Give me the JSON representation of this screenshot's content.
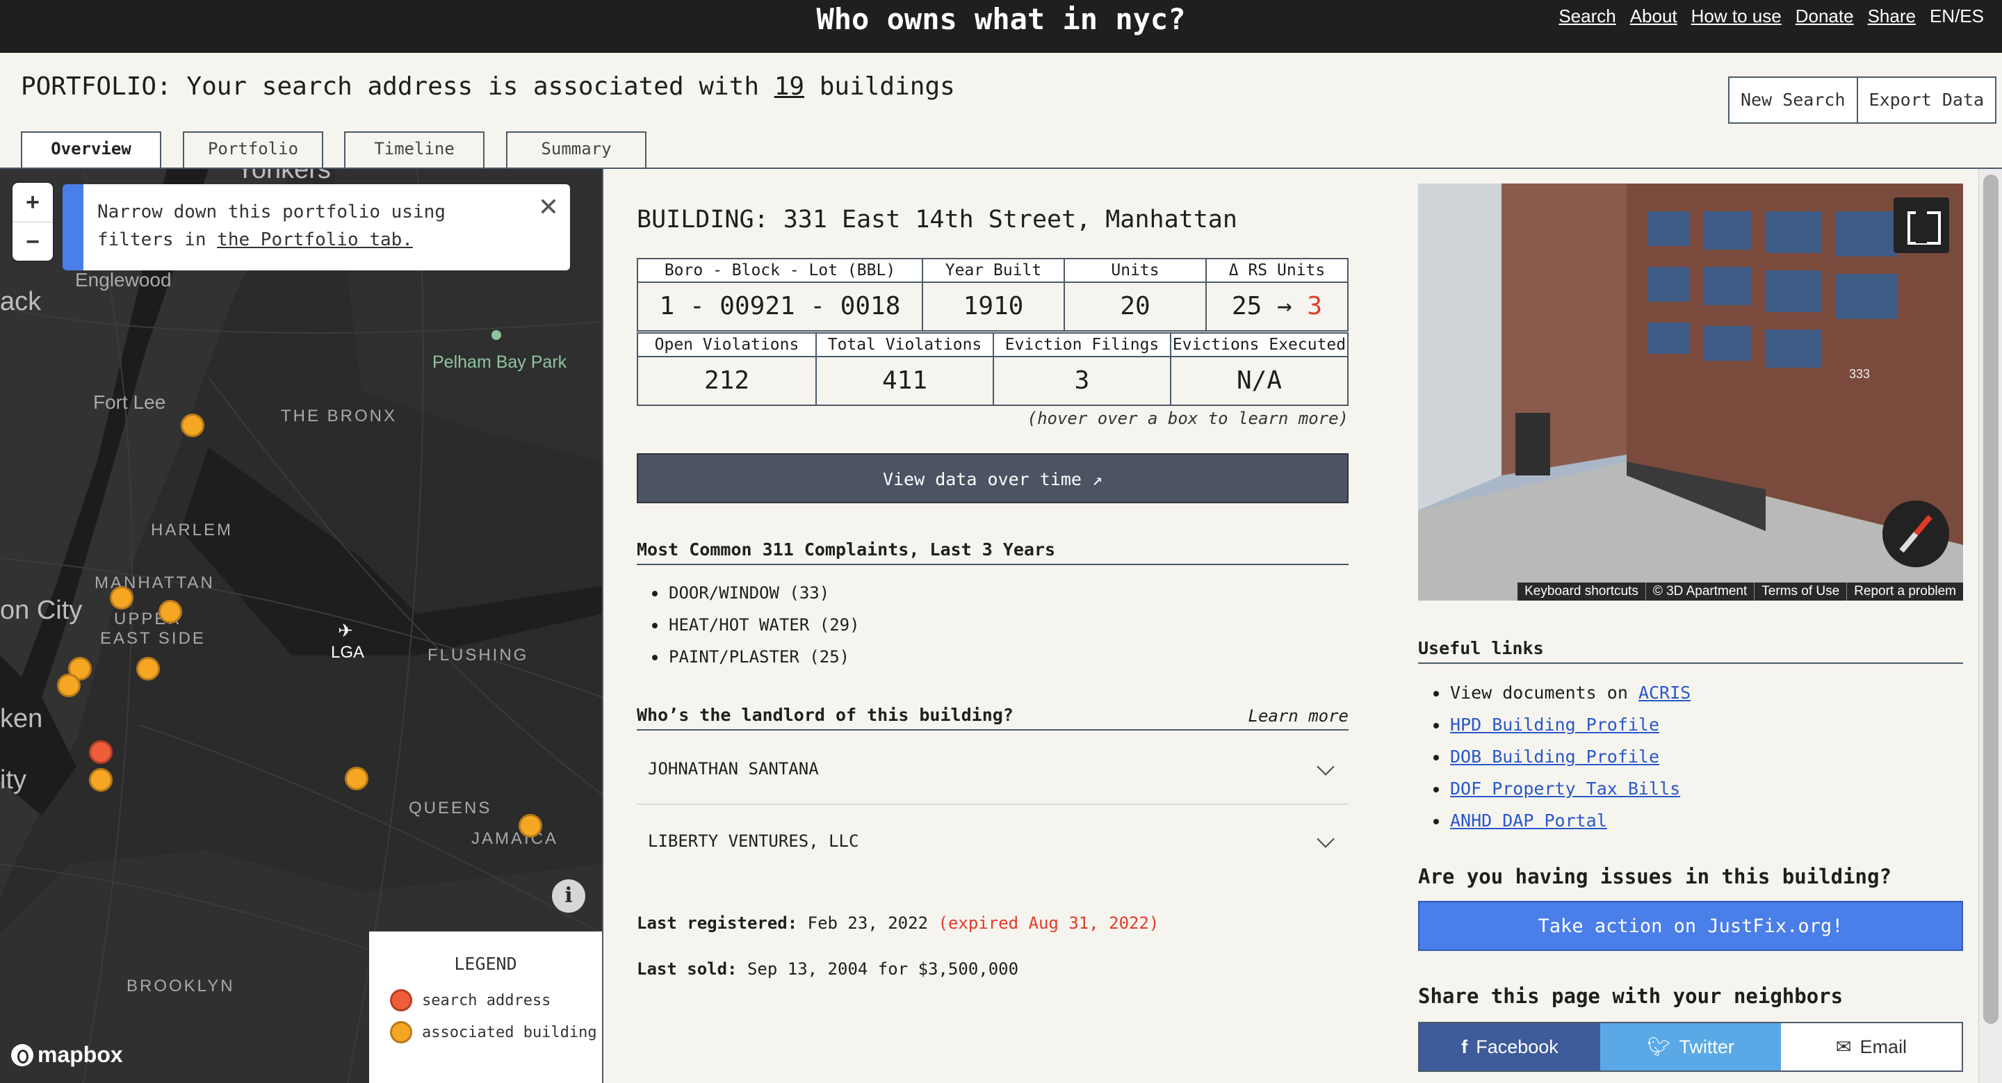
{
  "site": {
    "title": "Who owns what in nyc?",
    "nav": [
      "Search",
      "About",
      "How to use",
      "Donate",
      "Share",
      "EN/ES"
    ]
  },
  "portfolio": {
    "prefix": "PORTFOLIO: Your search address is associated with ",
    "count": "19",
    "suffix": " buildings",
    "new_search": "New Search",
    "export": "Export Data"
  },
  "tabs": [
    "Overview",
    "Portfolio",
    "Timeline",
    "Summary"
  ],
  "map": {
    "zoom_in": "+",
    "zoom_out": "−",
    "filter_note": "Narrow down this portfolio using filters in ",
    "filter_link": "the Portfolio tab.",
    "close": "✕",
    "labels": {
      "yonkers": "Yonkers",
      "englewood": "Englewood",
      "hack": "ack",
      "fort_lee": "Fort Lee",
      "bronx": "THE BRONX",
      "pelham": "Pelham Bay Park",
      "harlem": "HARLEM",
      "manhattan": "MANHATTAN",
      "upper": "UPPER",
      "east_side": "EAST SIDE",
      "on_city": "on City",
      "lga": "LGA",
      "flushing": "FLUSHING",
      "ken": "ken",
      "ity": "ity",
      "queens": "QUEENS",
      "jamaica": "JAMAICA",
      "brooklyn": "BROOKLYN"
    },
    "info": "i",
    "mapbox": "mapbox",
    "legend": {
      "title": "LEGEND",
      "search": "search address",
      "associated": "associated building"
    },
    "colors": {
      "search": "#ee5e3b",
      "associated": "#f5a623"
    }
  },
  "building": {
    "title": "BUILDING: 331 East 14th Street, Manhattan",
    "row1": {
      "bbl_label": "Boro - Block - Lot (BBL)",
      "bbl": "1 - 00921 - 0018",
      "year_label": "Year Built",
      "year": "1910",
      "units_label": "Units",
      "units": "20",
      "rs_label": "Δ RS Units",
      "rs_from": "25 → ",
      "rs_to": "3"
    },
    "row2": {
      "open_label": "Open Violations",
      "open": "212",
      "total_label": "Total Violations",
      "total": "411",
      "eviction_label": "Eviction Filings",
      "eviction": "3",
      "executed_label": "Evictions Executed",
      "executed": "N/A"
    },
    "hover_hint": "(hover over a box to learn more)",
    "view_data": "View data over time ↗",
    "complaints_head": "Most Common 311 Complaints, Last 3 Years",
    "complaints": [
      "DOOR/WINDOW (33)",
      "HEAT/HOT WATER (29)",
      "PAINT/PLASTER (25)"
    ],
    "landlord_head": "Who’s the landlord of this building?",
    "learn_more": "Learn more",
    "landlords": [
      "JOHNATHAN SANTANA",
      "LIBERTY VENTURES, LLC"
    ],
    "last_registered_label": "Last registered:",
    "last_registered": " Feb 23, 2022 ",
    "expired": "(expired Aug 31, 2022)",
    "last_sold_label": "Last sold:",
    "last_sold": " Sep 13, 2004 for $3,500,000"
  },
  "streetview": {
    "footer": [
      "Keyboard shortcuts",
      "© 3D Apartment",
      "Terms of Use",
      "Report a problem"
    ],
    "number": "333"
  },
  "links": {
    "head": "Useful links",
    "acris_prefix": "View documents on ",
    "acris": "ACRIS",
    "items": [
      "HPD Building Profile",
      "DOB Building Profile",
      "DOF Property Tax Bills",
      "ANHD DAP Portal"
    ],
    "issues_head": "Are you having issues in this building?",
    "justfix": "Take action on JustFix.org!",
    "share_head": "Share this page with your neighbors",
    "facebook": "Facebook",
    "twitter": "Twitter",
    "email": "Email"
  }
}
